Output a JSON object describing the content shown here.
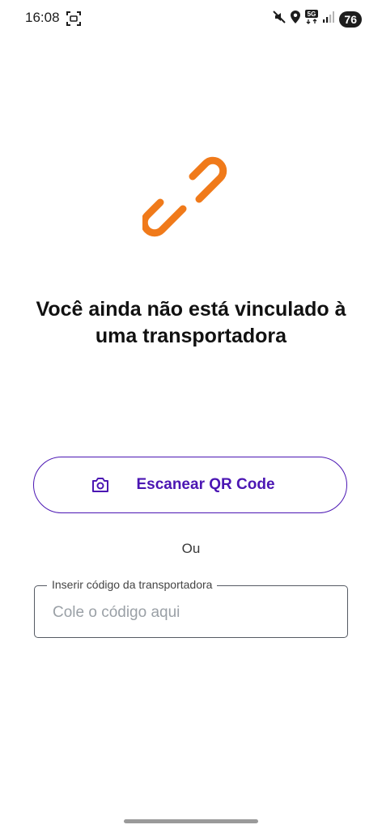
{
  "status_bar": {
    "time": "16:08",
    "network": "5G",
    "battery": "76"
  },
  "empty_state": {
    "title": "Você ainda não está vinculado à uma transportadora",
    "icon": "link-broken-icon",
    "icon_color": "#f07a1a"
  },
  "scan_button": {
    "label": "Escanear QR Code",
    "icon": "camera-icon",
    "color": "#4b16b3"
  },
  "separator": {
    "text": "Ou"
  },
  "code_field": {
    "label": "Inserir código da transportadora",
    "placeholder": "Cole o código aqui",
    "value": ""
  }
}
